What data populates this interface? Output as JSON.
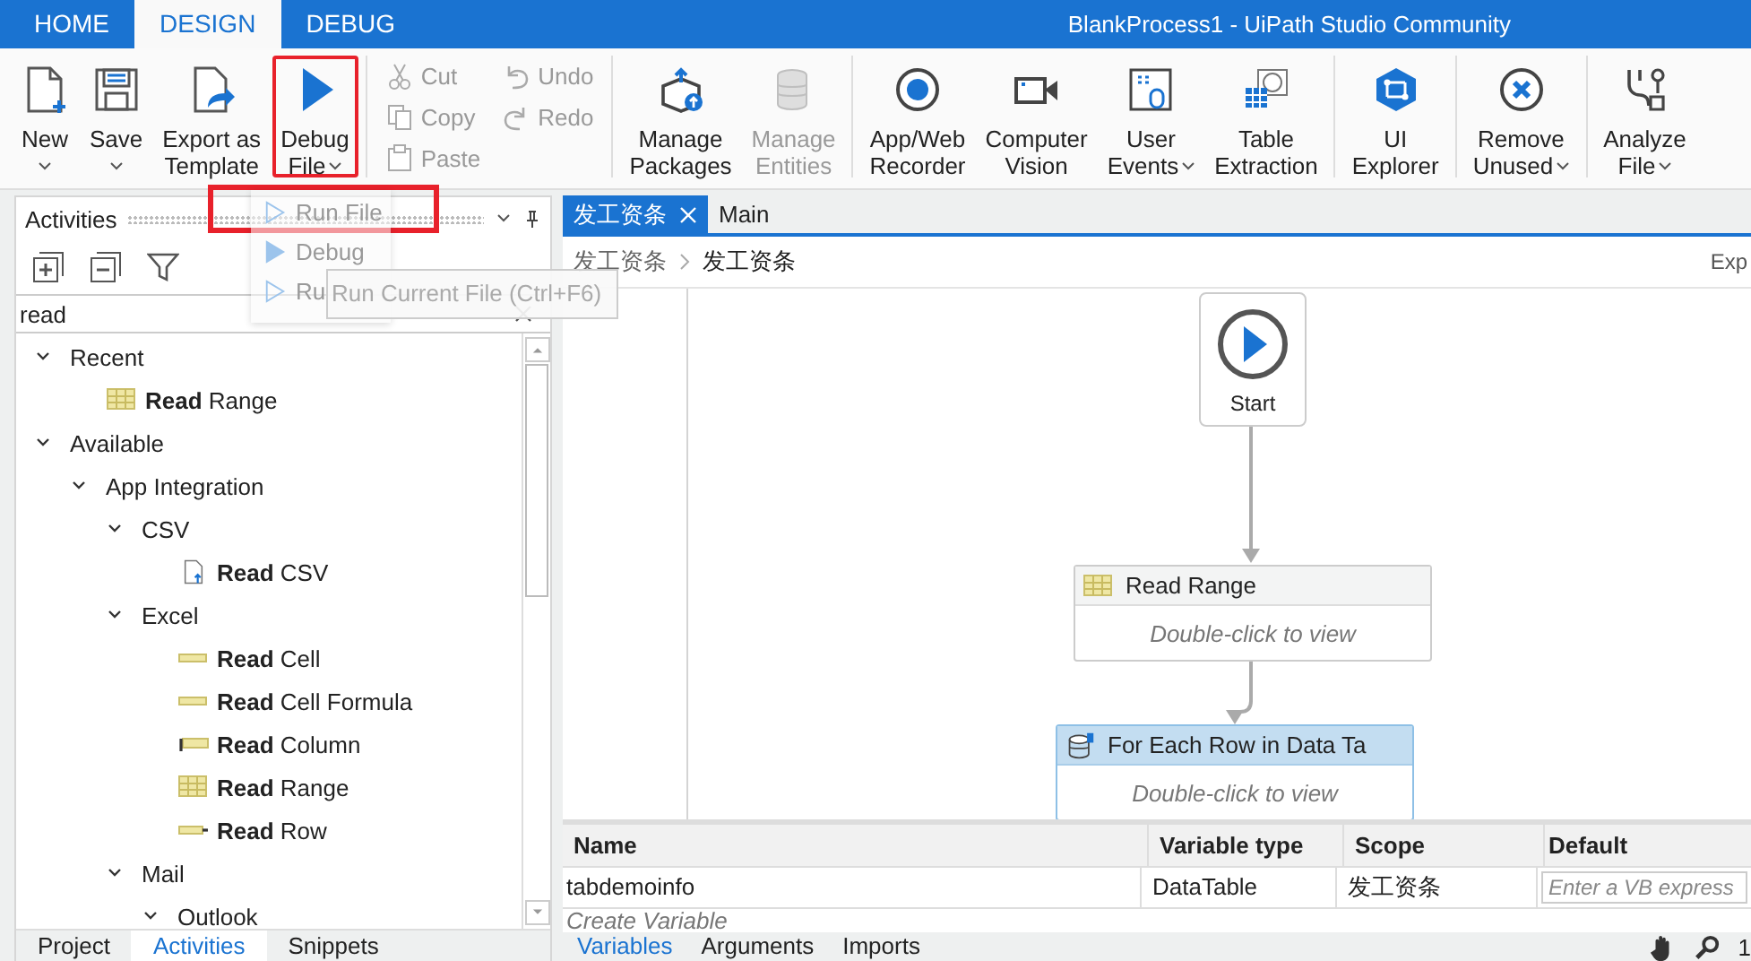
{
  "window": {
    "title": "BlankProcess1 - UiPath Studio Community"
  },
  "ribbon_tabs": [
    {
      "label": "HOME",
      "selected": false
    },
    {
      "label": "DESIGN",
      "selected": true
    },
    {
      "label": "DEBUG",
      "selected": false
    }
  ],
  "ribbon": {
    "groups": [
      {
        "buttons": [
          {
            "kind": "large",
            "lines": [
              "New"
            ],
            "menu": true,
            "disabled": false,
            "highlighted": false
          },
          {
            "kind": "large",
            "lines": [
              "Save"
            ],
            "menu": true,
            "disabled": false,
            "highlighted": false
          },
          {
            "kind": "large",
            "lines": [
              "Export as",
              "Template"
            ],
            "menu": false,
            "disabled": false,
            "highlighted": false
          },
          {
            "kind": "large",
            "lines": [
              "Debug",
              "File"
            ],
            "menu": true,
            "disabled": false,
            "highlighted": true
          }
        ]
      },
      {
        "buttons": [
          {
            "kind": "small",
            "lines": [
              "Cut"
            ],
            "disabled": true
          },
          {
            "kind": "small",
            "lines": [
              "Copy"
            ],
            "disabled": true
          },
          {
            "kind": "small",
            "lines": [
              "Paste"
            ],
            "disabled": true
          },
          {
            "kind": "small",
            "lines": [
              "Undo"
            ],
            "disabled": true
          },
          {
            "kind": "small",
            "lines": [
              "Redo"
            ],
            "disabled": true
          }
        ]
      },
      {
        "buttons": [
          {
            "kind": "large",
            "lines": [
              "Manage",
              "Packages"
            ],
            "menu": false,
            "disabled": false,
            "highlighted": false
          },
          {
            "kind": "large",
            "lines": [
              "Manage",
              "Entities"
            ],
            "menu": false,
            "disabled": true,
            "highlighted": false
          }
        ]
      },
      {
        "buttons": [
          {
            "kind": "large",
            "lines": [
              "App/Web",
              "Recorder"
            ],
            "menu": false,
            "disabled": false,
            "highlighted": false
          },
          {
            "kind": "large",
            "lines": [
              "Computer",
              "Vision"
            ],
            "menu": false,
            "disabled": false,
            "highlighted": false
          },
          {
            "kind": "large",
            "lines": [
              "User",
              "Events"
            ],
            "menu": true,
            "disabled": false,
            "highlighted": false
          },
          {
            "kind": "large",
            "lines": [
              "Table",
              "Extraction"
            ],
            "menu": false,
            "disabled": false,
            "highlighted": false
          }
        ]
      },
      {
        "buttons": [
          {
            "kind": "large",
            "lines": [
              "UI",
              "Explorer"
            ],
            "menu": false,
            "disabled": false,
            "highlighted": false
          }
        ]
      },
      {
        "buttons": [
          {
            "kind": "large",
            "lines": [
              "Remove",
              "Unused"
            ],
            "menu": true,
            "disabled": false,
            "highlighted": false
          }
        ]
      },
      {
        "buttons": [
          {
            "kind": "large",
            "lines": [
              "Analyze",
              "File"
            ],
            "menu": true,
            "disabled": false,
            "highlighted": false
          }
        ]
      }
    ]
  },
  "debug_menu": {
    "items": [
      {
        "label": "Run File",
        "highlighted": true
      },
      {
        "label": "Debug",
        "highlighted": false
      },
      {
        "label": "Ru",
        "highlighted": false
      }
    ]
  },
  "tooltip": "Run Current File (Ctrl+F6)",
  "activities_panel": {
    "title": "Activities",
    "search": {
      "value": "read"
    },
    "tree": [
      {
        "label": "Recent",
        "expanded": true,
        "children": [
          {
            "label": "**Read** Range"
          }
        ]
      },
      {
        "label": "Available",
        "expanded": true,
        "children": [
          {
            "label": "App Integration",
            "expanded": true,
            "children": [
              {
                "label": "CSV",
                "expanded": true,
                "children": [
                  {
                    "label": "**Read** CSV"
                  }
                ]
              },
              {
                "label": "Excel",
                "expanded": true,
                "children": [
                  {
                    "label": "**Read** Cell"
                  },
                  {
                    "label": "**Read** Cell Formula"
                  },
                  {
                    "label": "**Read** Column"
                  },
                  {
                    "label": "**Read** Range"
                  },
                  {
                    "label": "**Read** Row"
                  }
                ]
              },
              {
                "label": "Mail",
                "expanded": true,
                "children": [
                  {
                    "label": "Outlook",
                    "expanded": true
                  }
                ]
              }
            ]
          }
        ]
      }
    ],
    "bottom_tabs": [
      {
        "label": "Project",
        "selected": false
      },
      {
        "label": "Activities",
        "selected": true
      },
      {
        "label": "Snippets",
        "selected": false
      }
    ]
  },
  "designer": {
    "doc_tabs": [
      {
        "label": "发工资条",
        "selected": true,
        "closable": true
      },
      {
        "label": "Main",
        "selected": false,
        "closable": false
      }
    ],
    "breadcrumb": [
      "发工资条",
      "发工资条"
    ],
    "expand_link": "Exp",
    "start": {
      "label": "Start"
    },
    "activities": [
      {
        "title": "Read Range",
        "hint": "Double-click to view",
        "selected": false
      },
      {
        "title": "For Each Row in Data Ta",
        "hint": "Double-click to view",
        "selected": true
      }
    ]
  },
  "variables": {
    "columns": [
      "Name",
      "Variable type",
      "Scope",
      "Default"
    ],
    "rows": [
      {
        "name": "tabdemoinfo",
        "type": "DataTable",
        "scope": "发工资条",
        "default_placeholder": "Enter a VB express"
      }
    ],
    "create_hint": "Create Variable",
    "tabs": [
      {
        "label": "Variables",
        "selected": true
      },
      {
        "label": "Arguments",
        "selected": false
      },
      {
        "label": "Imports",
        "selected": false
      }
    ],
    "status_text": "1"
  }
}
